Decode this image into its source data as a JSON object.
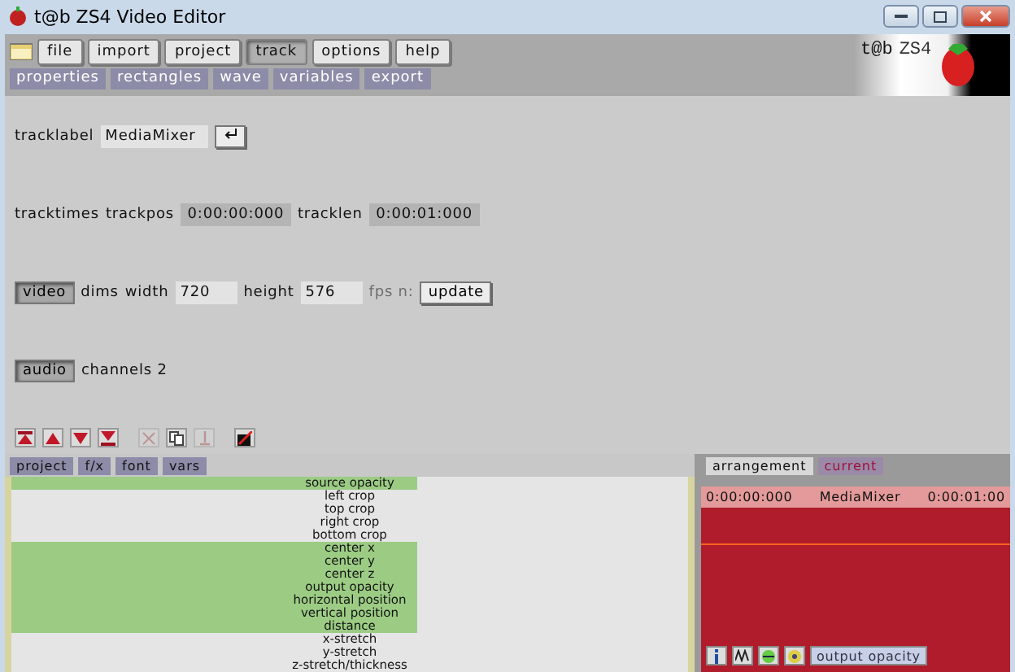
{
  "window": {
    "title": "t@b ZS4 Video Editor"
  },
  "menu": [
    {
      "label": "file",
      "selected": false
    },
    {
      "label": "import",
      "selected": false
    },
    {
      "label": "project",
      "selected": false
    },
    {
      "label": "track",
      "selected": true
    },
    {
      "label": "options",
      "selected": false
    },
    {
      "label": "help",
      "selected": false
    }
  ],
  "submenu": [
    "properties",
    "rectangles",
    "wave",
    "variables",
    "export"
  ],
  "logo": {
    "text_1": "t@b",
    "text_2": "ZS4"
  },
  "track": {
    "label_caption": "tracklabel",
    "label_value": "MediaMixer",
    "times_caption": "tracktimes",
    "pos_caption": "trackpos",
    "pos_value": "0:00:00:000",
    "len_caption": "tracklen",
    "len_value": "0:00:01:000",
    "video_toggle": {
      "label": "video",
      "on": true
    },
    "dims_caption": "dims",
    "width_caption": "width",
    "width_value": "720",
    "height_caption": "height",
    "height_value": "576",
    "fps_caption": "fps n:",
    "update_button": "update",
    "audio_toggle": {
      "label": "audio",
      "on": true
    },
    "channels_caption": "channels 2"
  },
  "tools": [
    {
      "kind": "top",
      "disabled": false
    },
    {
      "kind": "up",
      "disabled": false
    },
    {
      "kind": "down",
      "disabled": false
    },
    {
      "kind": "bottom",
      "disabled": false
    },
    {
      "kind": "cut",
      "disabled": true
    },
    {
      "kind": "copy",
      "disabled": false
    },
    {
      "kind": "paste",
      "disabled": true
    },
    {
      "kind": "delete",
      "disabled": false
    }
  ],
  "bottom_tabs": [
    "project",
    "f/x",
    "font",
    "vars"
  ],
  "params": [
    {
      "label": "source opacity",
      "selected": true
    },
    {
      "label": "left crop",
      "selected": false
    },
    {
      "label": "top crop",
      "selected": false
    },
    {
      "label": "right crop",
      "selected": false
    },
    {
      "label": "bottom crop",
      "selected": false
    },
    {
      "label": "center x",
      "selected": true
    },
    {
      "label": "center y",
      "selected": true
    },
    {
      "label": "center z",
      "selected": true
    },
    {
      "label": "output opacity",
      "selected": true
    },
    {
      "label": "horizontal position",
      "selected": true
    },
    {
      "label": "vertical position",
      "selected": true
    },
    {
      "label": "distance",
      "selected": true
    },
    {
      "label": "x-stretch",
      "selected": false
    },
    {
      "label": "y-stretch",
      "selected": false
    },
    {
      "label": "z-stretch/thickness",
      "selected": false
    }
  ],
  "right_tabs": [
    {
      "label": "arrangement",
      "selected": true
    },
    {
      "label": "current",
      "selected": false
    }
  ],
  "timeline": {
    "start": "0:00:00:000",
    "name": "MediaMixer",
    "end": "0:00:01:00"
  },
  "right_buttons": {
    "opacity_button": "output opacity"
  }
}
